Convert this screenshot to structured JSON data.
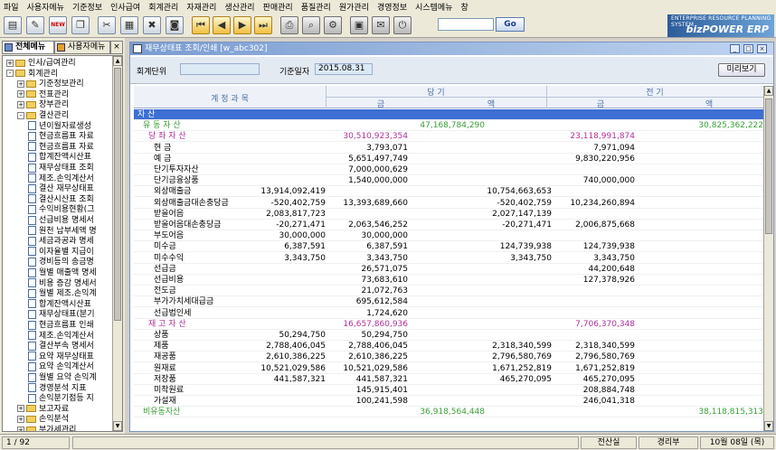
{
  "menu": [
    "파일",
    "사용자메뉴",
    "기준정보",
    "인사급여",
    "회계관리",
    "자재관리",
    "생산관리",
    "판매관리",
    "품질관리",
    "원가관리",
    "경영정보",
    "시스템메뉴",
    "창"
  ],
  "toolbar": {
    "new_badge": "NEW",
    "go_label": "Go",
    "search_value": ""
  },
  "brand": {
    "tagline": "ENTERPRISE RESOURCE PLANNING SYSTEM",
    "name": "bizPOWER ERP"
  },
  "left_panel": {
    "tabs": [
      "전체메뉴",
      "사용자메뉴"
    ],
    "tree": [
      {
        "label": "인사/급여관리",
        "level": 0,
        "type": "folder",
        "expander": "+"
      },
      {
        "label": "회계관리",
        "level": 0,
        "type": "folder",
        "expander": "-"
      },
      {
        "label": "기준정보관리",
        "level": 1,
        "type": "folder",
        "expander": "+"
      },
      {
        "label": "전표관리",
        "level": 1,
        "type": "folder",
        "expander": "+"
      },
      {
        "label": "장부관리",
        "level": 1,
        "type": "folder",
        "expander": "+"
      },
      {
        "label": "결산관리",
        "level": 1,
        "type": "folder",
        "expander": "-"
      },
      {
        "label": "년이월자료생성",
        "level": 2,
        "type": "doc"
      },
      {
        "label": "현금흐름표 자료",
        "level": 2,
        "type": "doc"
      },
      {
        "label": "현금흐름표 자료",
        "level": 2,
        "type": "doc"
      },
      {
        "label": "합계잔액시산표",
        "level": 2,
        "type": "doc"
      },
      {
        "label": "재무상태표 조회",
        "level": 2,
        "type": "doc",
        "selected": true
      },
      {
        "label": "제조.손익계산서",
        "level": 2,
        "type": "doc"
      },
      {
        "label": "결산 재무상태표",
        "level": 2,
        "type": "doc"
      },
      {
        "label": "결산시산표 조회",
        "level": 2,
        "type": "doc"
      },
      {
        "label": "수익비용현황(그",
        "level": 2,
        "type": "doc"
      },
      {
        "label": "선급비용 명세서",
        "level": 2,
        "type": "doc"
      },
      {
        "label": "원천 납부세액 명",
        "level": 2,
        "type": "doc"
      },
      {
        "label": "세금과공과 명세",
        "level": 2,
        "type": "doc"
      },
      {
        "label": "이자율별 지급이",
        "level": 2,
        "type": "doc"
      },
      {
        "label": "경비등의 송금명",
        "level": 2,
        "type": "doc"
      },
      {
        "label": "월별 매출액 명세",
        "level": 2,
        "type": "doc"
      },
      {
        "label": "비용 증감 명세서",
        "level": 2,
        "type": "doc"
      },
      {
        "label": "월별 제조.손익계",
        "level": 2,
        "type": "doc"
      },
      {
        "label": "합계잔액시산표",
        "level": 2,
        "type": "doc"
      },
      {
        "label": "재무상태표(분기",
        "level": 2,
        "type": "doc"
      },
      {
        "label": "현금흐름표 인쇄",
        "level": 2,
        "type": "doc"
      },
      {
        "label": "제조.손익계산서",
        "level": 2,
        "type": "doc"
      },
      {
        "label": "결산부속 명세서",
        "level": 2,
        "type": "doc"
      },
      {
        "label": "요약 재무상태표",
        "level": 2,
        "type": "doc"
      },
      {
        "label": "요약 손익계산서",
        "level": 2,
        "type": "doc"
      },
      {
        "label": "월별 요약 손익계",
        "level": 2,
        "type": "doc"
      },
      {
        "label": "경영분석 지표",
        "level": 2,
        "type": "doc"
      },
      {
        "label": "손익분기점등 지",
        "level": 2,
        "type": "doc"
      },
      {
        "label": "보고자료",
        "level": 1,
        "type": "folder",
        "expander": "+"
      },
      {
        "label": "손익분석",
        "level": 1,
        "type": "folder",
        "expander": "+"
      },
      {
        "label": "부가세관리",
        "level": 1,
        "type": "folder",
        "expander": "+"
      }
    ]
  },
  "window": {
    "title": "재무상태표 조회/인쇄 [w_abc302]",
    "controls": [
      "_",
      "□",
      "×"
    ],
    "filter": {
      "unit_label": "회계단위",
      "unit_value": "",
      "date_label": "기준일자",
      "date_value": "2015.08.31",
      "preview_button": "미리보기"
    },
    "grid": {
      "headers": {
        "account": "계 정 과 목",
        "current": "당 기",
        "previous": "전 기",
        "amount1": "금",
        "amount2": "액",
        "amount3": "금",
        "amount4": "액"
      },
      "rows": [
        {
          "name": "자    산",
          "indent": 0,
          "style": "hl",
          "c1": "",
          "c2": "",
          "c3": "",
          "c4": "",
          "c5": "",
          "c6": ""
        },
        {
          "name": "유 동 자 산",
          "indent": 1,
          "style": "g",
          "c1": "",
          "c2": "",
          "c3": "47,168,784,290",
          "c4": "",
          "c5": "",
          "c6": "30,825,362,222"
        },
        {
          "name": "당 좌 자 산",
          "indent": 2,
          "style": "p",
          "c1": "",
          "c2": "30,510,923,354",
          "c3": "",
          "c4": "",
          "c5": "23,118,991,874",
          "c6": ""
        },
        {
          "name": "현        금",
          "indent": 3,
          "style": "",
          "c1": "",
          "c2": "3,793,071",
          "c3": "",
          "c4": "",
          "c5": "7,971,094",
          "c6": ""
        },
        {
          "name": "예        금",
          "indent": 3,
          "style": "",
          "c1": "",
          "c2": "5,651,497,749",
          "c3": "",
          "c4": "",
          "c5": "9,830,220,956",
          "c6": ""
        },
        {
          "name": "단기투자자산",
          "indent": 3,
          "style": "",
          "c1": "",
          "c2": "7,000,000,629",
          "c3": "",
          "c4": "",
          "c5": "",
          "c6": ""
        },
        {
          "name": "단기금융상품",
          "indent": 3,
          "style": "",
          "c1": "",
          "c2": "1,540,000,000",
          "c3": "",
          "c4": "",
          "c5": "740,000,000",
          "c6": ""
        },
        {
          "name": "외상매출금",
          "indent": 3,
          "style": "",
          "c1": "13,914,092,419",
          "c2": "",
          "c3": "",
          "c4": "10,754,663,653",
          "c5": "",
          "c6": ""
        },
        {
          "name": "외상매출금대손충당금",
          "indent": 3,
          "style": "",
          "c1": "-520,402,759",
          "c2": "13,393,689,660",
          "c3": "",
          "c4": "-520,402,759",
          "c5": "10,234,260,894",
          "c6": ""
        },
        {
          "name": "받을어음",
          "indent": 3,
          "style": "",
          "c1": "2,083,817,723",
          "c2": "",
          "c3": "",
          "c4": "2,027,147,139",
          "c5": "",
          "c6": ""
        },
        {
          "name": "받을어음대손충당금",
          "indent": 3,
          "style": "",
          "c1": "-20,271,471",
          "c2": "2,063,546,252",
          "c3": "",
          "c4": "-20,271,471",
          "c5": "2,006,875,668",
          "c6": ""
        },
        {
          "name": "부도어음",
          "indent": 3,
          "style": "",
          "c1": "30,000,000",
          "c2": "30,000,000",
          "c3": "",
          "c4": "",
          "c5": "",
          "c6": ""
        },
        {
          "name": "미수금",
          "indent": 3,
          "style": "",
          "c1": "6,387,591",
          "c2": "6,387,591",
          "c3": "",
          "c4": "124,739,938",
          "c5": "124,739,938",
          "c6": ""
        },
        {
          "name": "미수수익",
          "indent": 3,
          "style": "",
          "c1": "3,343,750",
          "c2": "3,343,750",
          "c3": "",
          "c4": "3,343,750",
          "c5": "3,343,750",
          "c6": ""
        },
        {
          "name": "선급금",
          "indent": 3,
          "style": "",
          "c1": "",
          "c2": "26,571,075",
          "c3": "",
          "c4": "",
          "c5": "44,200,648",
          "c6": ""
        },
        {
          "name": "선급비용",
          "indent": 3,
          "style": "",
          "c1": "",
          "c2": "73,683,610",
          "c3": "",
          "c4": "",
          "c5": "127,378,926",
          "c6": ""
        },
        {
          "name": "전도금",
          "indent": 3,
          "style": "",
          "c1": "",
          "c2": "21,072,763",
          "c3": "",
          "c4": "",
          "c5": "",
          "c6": ""
        },
        {
          "name": "부가가치세대급금",
          "indent": 3,
          "style": "",
          "c1": "",
          "c2": "695,612,584",
          "c3": "",
          "c4": "",
          "c5": "",
          "c6": ""
        },
        {
          "name": "선급법인세",
          "indent": 3,
          "style": "",
          "c1": "",
          "c2": "1,724,620",
          "c3": "",
          "c4": "",
          "c5": "",
          "c6": ""
        },
        {
          "name": "재 고 자 산",
          "indent": 2,
          "style": "p",
          "c1": "",
          "c2": "16,657,860,936",
          "c3": "",
          "c4": "",
          "c5": "7,706,370,348",
          "c6": ""
        },
        {
          "name": "상품",
          "indent": 3,
          "style": "",
          "c1": "50,294,750",
          "c2": "50,294,750",
          "c3": "",
          "c4": "",
          "c5": "",
          "c6": ""
        },
        {
          "name": "제품",
          "indent": 3,
          "style": "",
          "c1": "2,788,406,045",
          "c2": "2,788,406,045",
          "c3": "",
          "c4": "2,318,340,599",
          "c5": "2,318,340,599",
          "c6": ""
        },
        {
          "name": "재공품",
          "indent": 3,
          "style": "",
          "c1": "2,610,386,225",
          "c2": "2,610,386,225",
          "c3": "",
          "c4": "2,796,580,769",
          "c5": "2,796,580,769",
          "c6": ""
        },
        {
          "name": "원재료",
          "indent": 3,
          "style": "",
          "c1": "10,521,029,586",
          "c2": "10,521,029,586",
          "c3": "",
          "c4": "1,671,252,819",
          "c5": "1,671,252,819",
          "c6": ""
        },
        {
          "name": "저장품",
          "indent": 3,
          "style": "",
          "c1": "441,587,321",
          "c2": "441,587,321",
          "c3": "",
          "c4": "465,270,095",
          "c5": "465,270,095",
          "c6": ""
        },
        {
          "name": "미착원료",
          "indent": 3,
          "style": "",
          "c1": "",
          "c2": "145,915,401",
          "c3": "",
          "c4": "",
          "c5": "208,884,748",
          "c6": ""
        },
        {
          "name": "가설재",
          "indent": 3,
          "style": "",
          "c1": "",
          "c2": "100,241,598",
          "c3": "",
          "c4": "",
          "c5": "246,041,318",
          "c6": ""
        },
        {
          "name": "비유동자산",
          "indent": 1,
          "style": "g",
          "c1": "",
          "c2": "",
          "c3": "36,918,564,448",
          "c4": "",
          "c5": "",
          "c6": "38,118,815,313"
        }
      ]
    }
  },
  "status": {
    "page": "1 / 92",
    "dept": "전산실",
    "role": "경리부",
    "date": "10월 08일 (목)"
  },
  "colors": {
    "highlight": "#3d6fd4",
    "group": "#3aa038",
    "subgroup": "#b0309a",
    "title_bar": "#7a9cd0"
  }
}
